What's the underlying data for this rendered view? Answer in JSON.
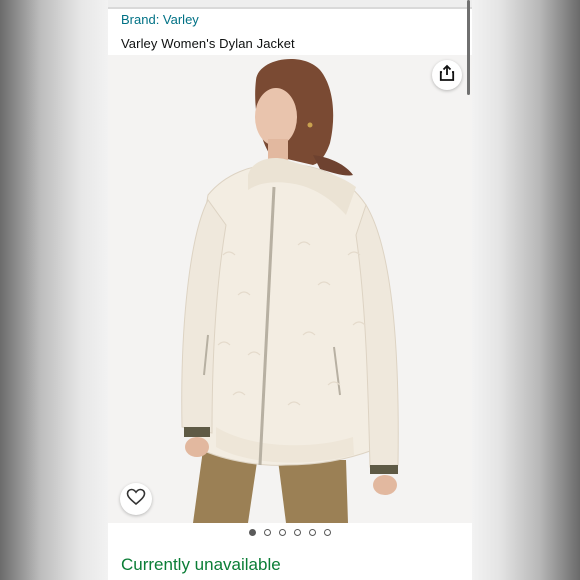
{
  "product": {
    "brand_label": "Brand: Varley",
    "title": "Varley Women's Dylan Jacket",
    "availability": "Currently unavailable"
  },
  "gallery": {
    "image_count": 6,
    "active_index": 0
  },
  "icons": {
    "share": "share-icon",
    "wishlist": "heart-icon"
  },
  "colors": {
    "link": "#007185",
    "availability": "#0a7d36"
  }
}
